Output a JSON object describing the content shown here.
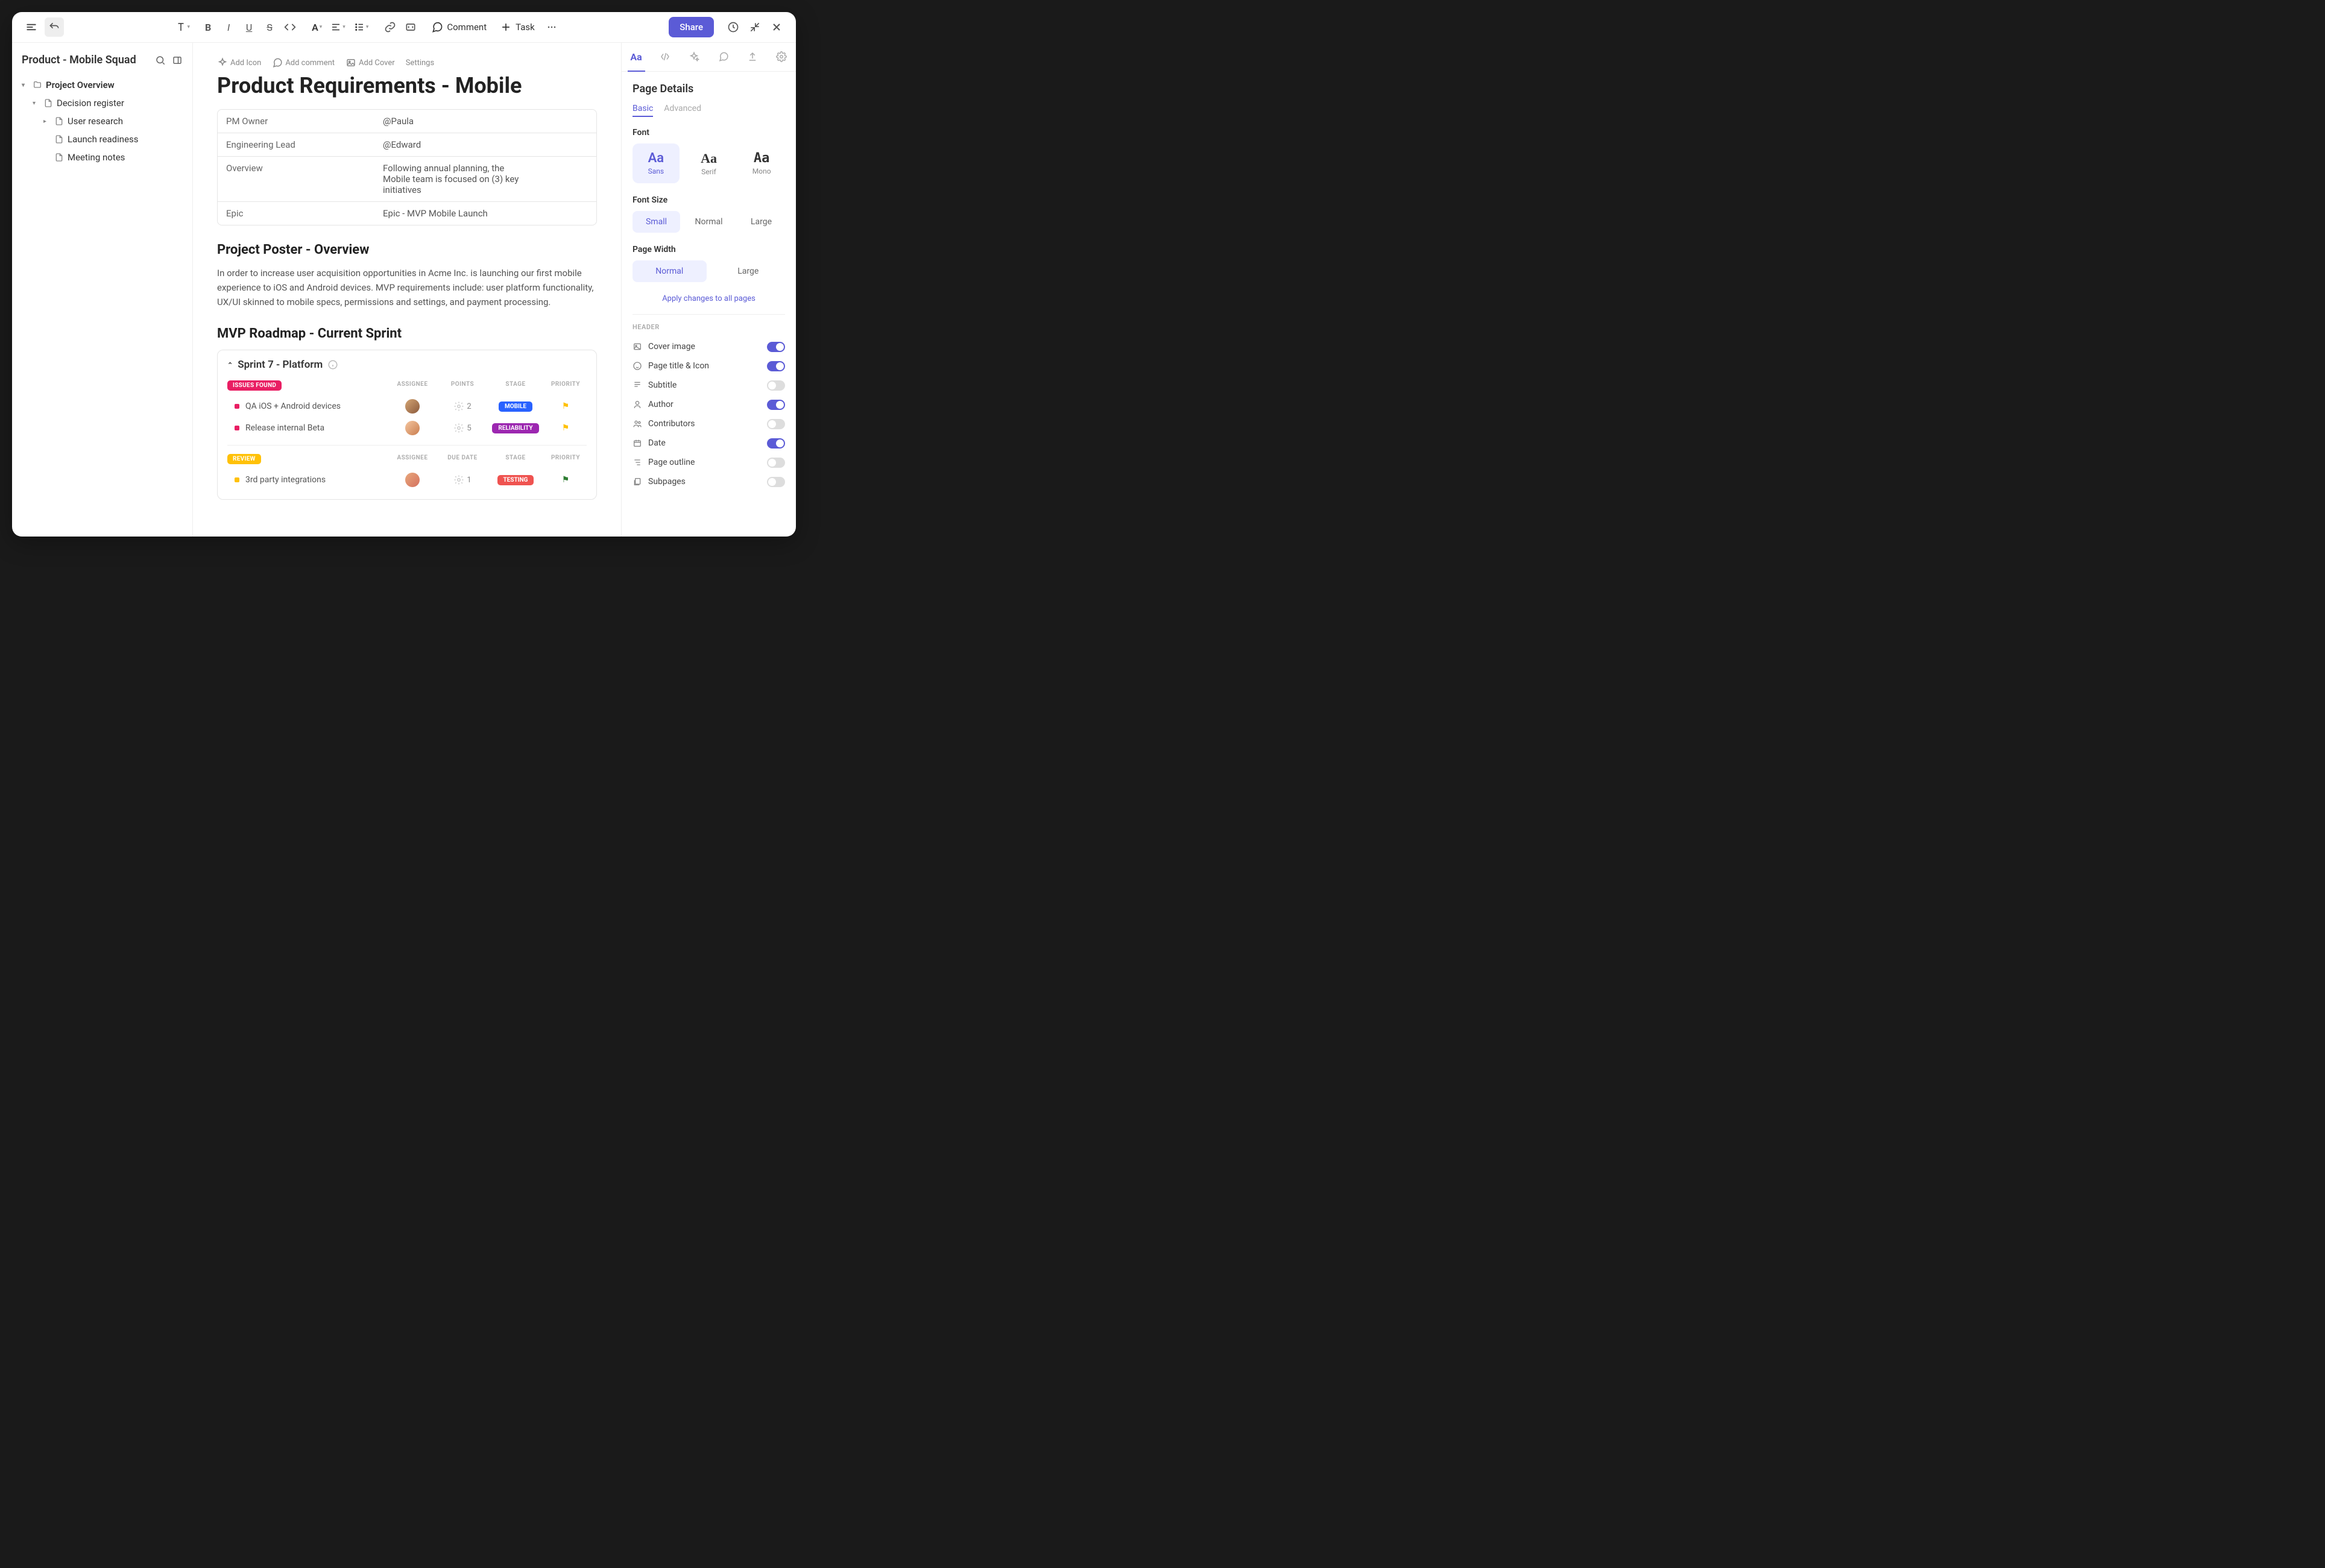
{
  "toolbar": {
    "comment": "Comment",
    "task": "Task",
    "share": "Share"
  },
  "sidebar": {
    "title": "Product - Mobile Squad",
    "tree": {
      "root": "Project Overview",
      "items": [
        "Decision register",
        "User research",
        "Launch readiness",
        "Meeting notes"
      ]
    }
  },
  "page": {
    "actions": {
      "addIcon": "Add Icon",
      "addComment": "Add comment",
      "addCover": "Add Cover",
      "settings": "Settings"
    },
    "title": "Product Requirements - Mobile",
    "info": [
      {
        "label": "PM Owner",
        "value": "@Paula"
      },
      {
        "label": "Engineering Lead",
        "value": "@Edward"
      },
      {
        "label": "Overview",
        "value": "Following annual planning, the Mobile team is focused on (3) key initiatives"
      },
      {
        "label": "Epic",
        "value": "Epic - MVP Mobile Launch"
      }
    ],
    "posterHeading": "Project Poster - Overview",
    "posterBody": "In order to increase user acquisition opportunities in Acme Inc. is launching our first mobile experience to iOS and Android devices. MVP requirements include: user platform functionality, UX/UI skinned to mobile specs, permissions and settings, and payment processing.",
    "roadmapHeading": "MVP Roadmap - Current Sprint",
    "sprint": {
      "title": "Sprint  7 - Platform",
      "groups": [
        {
          "status": "ISSUES FOUND",
          "cols": [
            "ASSIGNEE",
            "POINTS",
            "STAGE",
            "PRIORITY"
          ],
          "rows": [
            {
              "name": "QA iOS + Android devices",
              "points": "2",
              "stage": "MOBILE",
              "stageColor": "blue",
              "flag": "y"
            },
            {
              "name": "Release internal Beta",
              "points": "5",
              "stage": "RELIABILITY",
              "stageColor": "purple",
              "flag": "y"
            }
          ]
        },
        {
          "status": "REVIEW",
          "cols": [
            "ASSIGNEE",
            "DUE DATE",
            "STAGE",
            "PRIORITY"
          ],
          "rows": [
            {
              "name": "3rd party integrations",
              "points": "1",
              "stage": "TESTING",
              "stageColor": "red",
              "flag": "g"
            }
          ]
        }
      ]
    }
  },
  "panel": {
    "title": "Page Details",
    "subtabs": {
      "basic": "Basic",
      "advanced": "Advanced"
    },
    "fontLabel": "Font",
    "fonts": [
      {
        "sample": "Aa",
        "name": "Sans"
      },
      {
        "sample": "Aa",
        "name": "Serif"
      },
      {
        "sample": "Aa",
        "name": "Mono"
      }
    ],
    "fontSizeLabel": "Font Size",
    "sizes": [
      "Small",
      "Normal",
      "Large"
    ],
    "pageWidthLabel": "Page Width",
    "widths": [
      "Normal",
      "Large"
    ],
    "applyLink": "Apply changes to all pages",
    "headerLabel": "HEADER",
    "toggles": [
      {
        "label": "Cover image",
        "on": true
      },
      {
        "label": "Page title & Icon",
        "on": true
      },
      {
        "label": "Subtitle",
        "on": false
      },
      {
        "label": "Author",
        "on": true
      },
      {
        "label": "Contributors",
        "on": false
      },
      {
        "label": "Date",
        "on": true
      },
      {
        "label": "Page outline",
        "on": false
      },
      {
        "label": "Subpages",
        "on": false
      }
    ]
  }
}
